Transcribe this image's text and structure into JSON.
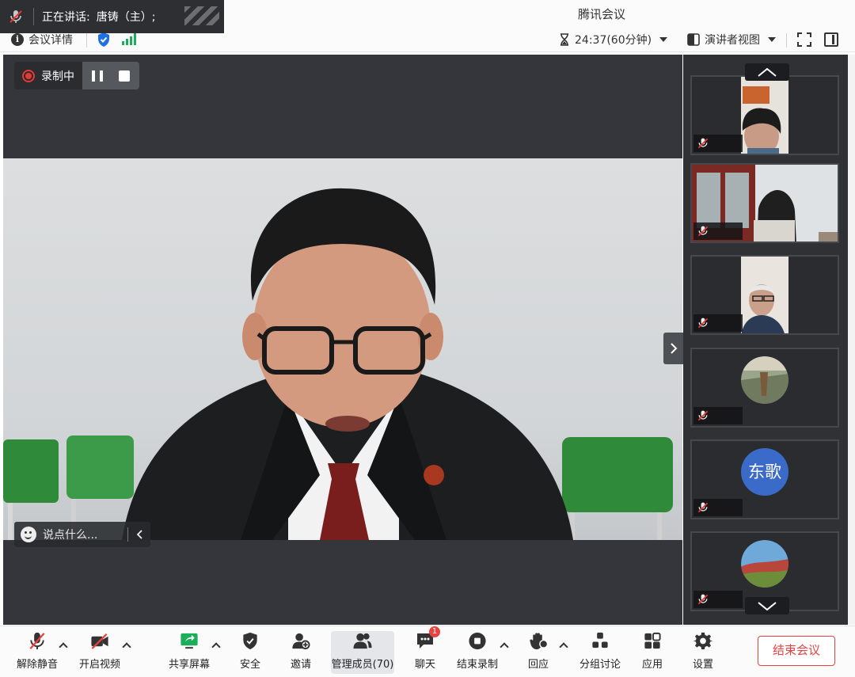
{
  "window": {
    "title": "腾讯会议"
  },
  "speaking": {
    "label": "正在讲话:",
    "name": "唐铸（主）;"
  },
  "infobar": {
    "meeting_details": "会议详情",
    "timer": "24:37(60分钟)",
    "view_mode": "演讲者视图"
  },
  "recording": {
    "status": "录制中"
  },
  "chat": {
    "placeholder": "说点什么..."
  },
  "participants": [
    {
      "type": "video",
      "muted": true
    },
    {
      "type": "video",
      "muted": true
    },
    {
      "type": "video",
      "muted": true
    },
    {
      "type": "avatar",
      "muted": true
    },
    {
      "type": "text-avatar",
      "avatar_text": "东歌",
      "muted": true
    },
    {
      "type": "avatar",
      "muted": true
    }
  ],
  "toolbar": {
    "unmute": "解除静音",
    "start_video": "开启视频",
    "share_screen": "共享屏幕",
    "security": "安全",
    "invite": "邀请",
    "manage_members": "管理成员(70)",
    "chat": "聊天",
    "chat_badge": "1",
    "end_recording": "结束录制",
    "reactions": "回应",
    "breakout": "分组讨论",
    "apps": "应用",
    "settings": "设置",
    "end_meeting": "结束会议"
  },
  "colors": {
    "accent_blue": "#1f6fe5",
    "danger": "#e8423f",
    "signal_green": "#1aad5a"
  }
}
